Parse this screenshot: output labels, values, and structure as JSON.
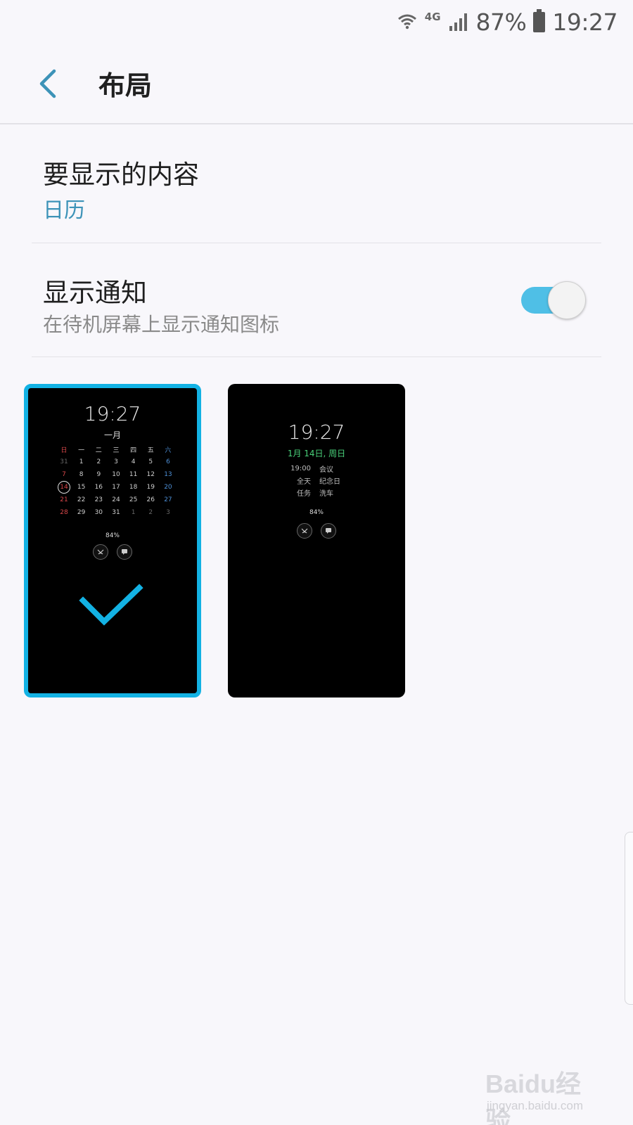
{
  "status_bar": {
    "network": "4G",
    "battery": "87%",
    "time": "19:27",
    "icons": [
      "wifi-icon",
      "signal-icon",
      "battery-icon"
    ]
  },
  "header": {
    "title": "布局",
    "back_icon": "chevron-left-icon"
  },
  "settings": {
    "content": {
      "title": "要显示的内容",
      "value": "日历"
    },
    "notification": {
      "title": "显示通知",
      "subtitle": "在待机屏幕上显示通知图标",
      "enabled": true
    }
  },
  "layouts": {
    "selected_index": 0,
    "calendar_preview": {
      "time": "19:27",
      "month": "一月",
      "weekdays": [
        "日",
        "一",
        "二",
        "三",
        "四",
        "五",
        "六"
      ],
      "weeks": [
        [
          "31",
          "1",
          "2",
          "3",
          "4",
          "5",
          "6"
        ],
        [
          "7",
          "8",
          "9",
          "10",
          "11",
          "12",
          "13"
        ],
        [
          "14",
          "15",
          "16",
          "17",
          "18",
          "19",
          "20"
        ],
        [
          "21",
          "22",
          "23",
          "24",
          "25",
          "26",
          "27"
        ],
        [
          "28",
          "29",
          "30",
          "31",
          "1",
          "2",
          "3"
        ]
      ],
      "today": "14",
      "battery": "84%"
    },
    "schedule_preview": {
      "time": "19:27",
      "date": "1月 14日, 周日",
      "events": [
        {
          "time": "19:00",
          "title": "会议"
        },
        {
          "time": "全天",
          "title": "纪念日"
        },
        {
          "time": "任务",
          "title": "洗车"
        }
      ],
      "battery": "84%"
    }
  },
  "colors": {
    "accent": "#13b2e4",
    "value_text": "#3d93b8",
    "toggle_on": "#4fbfe6",
    "date_green": "#49d17a"
  },
  "watermark": {
    "brand": "Baidu经验",
    "url": "jingyan.baidu.com"
  }
}
